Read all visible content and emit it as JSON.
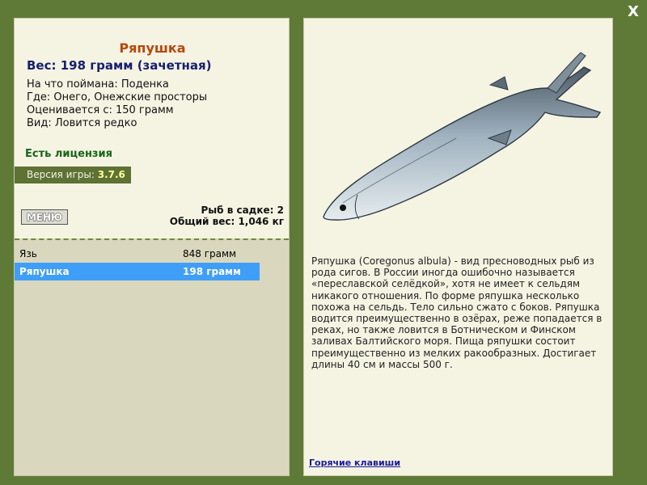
{
  "close_label": "X",
  "fish": {
    "title": "Ряпушка",
    "weight_line": "Вес: 198 грамм (зачетная)",
    "caught_on": "На что поймана: Поденка",
    "location": "Где: Онего, Онежские просторы",
    "valued_from": "Оценивается с: 150 грамм",
    "kind": "Вид: Ловится редко"
  },
  "license": "Есть лицензия",
  "version": {
    "label": "Версия игры:",
    "value": "3.7.6"
  },
  "menu_label": "МЕНЮ",
  "stats": {
    "fish_count": "Рыб в садке: 2",
    "total_weight": "Общий вес: 1,046 кг"
  },
  "catch_list": [
    {
      "name": "Язь",
      "weight": "848 грамм",
      "selected": false
    },
    {
      "name": "Ряпушка",
      "weight": "198 грамм",
      "selected": true
    }
  ],
  "description": "Ряпушка (Coregonus albula) - вид пресноводных рыб из рода сигов. В России иногда ошибочно называется «переславской селёдкой», хотя не имеет к сельдям никакого отношения. По форме ряпушка несколько похожа на сельдь. Тело сильно сжато с боков. Ряпушка водится преимущественно в озёрах, реже попадается в реках, но также ловится в Ботническом и Финском заливах Балтийского моря. Пища ряпушки состоит преимущественно из мелких ракообразных. Достигает длины 40 см и массы 500 г.",
  "hotkeys_label": "Горячие клавиши",
  "colors": {
    "frame": "#5f7a37",
    "panel": "#f5f3e2",
    "selected_row": "#3f9ef7",
    "title": "#b8480c",
    "weight": "#16206e",
    "license": "#17651b"
  }
}
